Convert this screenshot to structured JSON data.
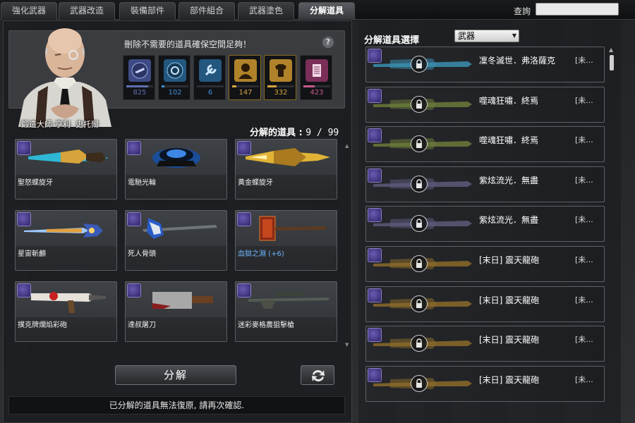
{
  "tabs": [
    {
      "label": "強化武器"
    },
    {
      "label": "武器改造"
    },
    {
      "label": "裝備部件"
    },
    {
      "label": "部件組合"
    },
    {
      "label": "武器塗色"
    },
    {
      "label": "分解道具"
    }
  ],
  "active_tab": "分解道具",
  "query": {
    "label": "查詢",
    "value": ""
  },
  "npc": {
    "name": "鍛造大師-亨利. 史托爾"
  },
  "notice": "刪除不需要的道具確保空間足夠！",
  "help_icon": "?",
  "counters": [
    {
      "icon": "weapon-icon",
      "value": "825",
      "color": "#5f6fb0",
      "fill": 0.82
    },
    {
      "icon": "part-icon",
      "value": "102",
      "color": "#3e8fd6",
      "fill": 0.1
    },
    {
      "icon": "wrench-icon",
      "value": "6",
      "color": "#3e8fd6",
      "fill": 0.01
    },
    {
      "icon": "character-icon",
      "value": "147",
      "color": "#d6a23e",
      "fill": 0.15
    },
    {
      "icon": "costume-icon",
      "value": "332",
      "color": "#d6a23e",
      "fill": 0.33
    },
    {
      "icon": "document-icon",
      "value": "423",
      "color": "#c85a8e",
      "fill": 0.42
    }
  ],
  "decompose_count": {
    "label": "分解的道具",
    "value": "9 / 99"
  },
  "items": [
    {
      "name": "聖怒蝶旋牙",
      "blue": false
    },
    {
      "name": "電馳光輪",
      "blue": false
    },
    {
      "name": "黃金蝶旋牙",
      "blue": false
    },
    {
      "name": "星宙斬顱",
      "blue": false
    },
    {
      "name": "死人骨頭",
      "blue": false
    },
    {
      "name": "血獄之淵 (+6)",
      "blue": true
    },
    {
      "name": "撲克牌爛焰彩砲",
      "blue": false
    },
    {
      "name": "達叔屠刀",
      "blue": false
    },
    {
      "name": "迷彩麥格農狙擊槍",
      "blue": false
    }
  ],
  "decompose_button": "分解",
  "warning": "已分解的道具無法復原, 請再次確認.",
  "right_panel": {
    "title": "分解道具選擇",
    "filter": "武器",
    "list": [
      {
        "name": "凜冬滅世．弗洛薩克",
        "grade": "[未..."
      },
      {
        "name": "噬魂狂嘯．終焉",
        "grade": "[未..."
      },
      {
        "name": "噬魂狂嘯．終焉",
        "grade": "[未..."
      },
      {
        "name": "紫炫流光．無盡",
        "grade": "[未..."
      },
      {
        "name": "紫炫流光．無盡",
        "grade": "[未..."
      },
      {
        "name": "[末日] 震天龍砲",
        "grade": "[未..."
      },
      {
        "name": "[末日] 震天龍砲",
        "grade": "[未..."
      },
      {
        "name": "[末日] 震天龍砲",
        "grade": "[未..."
      },
      {
        "name": "[末日] 震天龍砲",
        "grade": "[未..."
      }
    ]
  }
}
